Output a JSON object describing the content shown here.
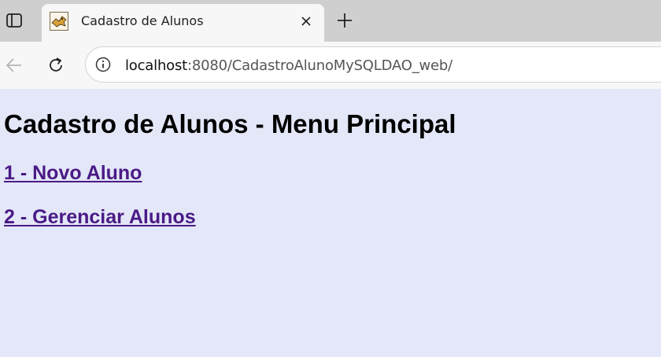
{
  "browser": {
    "tab": {
      "title": "Cadastro de Alunos",
      "favicon": "tomcat-icon"
    },
    "address_bar": {
      "host": "localhost",
      "path": ":8080/CadastroAlunoMySQLDAO_web/"
    },
    "icons": {
      "tab_actions": "tab-actions-icon",
      "close": "close-icon",
      "new_tab": "plus-icon",
      "back": "back-arrow-icon",
      "reload": "reload-icon",
      "site_info": "info-icon"
    }
  },
  "page": {
    "background": "#e3e7f7",
    "link_color": "#4b1a86",
    "heading": "Cadastro de Alunos - Menu Principal",
    "menu": [
      {
        "label": "1 - Novo Aluno"
      },
      {
        "label": "2 - Gerenciar Alunos"
      }
    ]
  }
}
